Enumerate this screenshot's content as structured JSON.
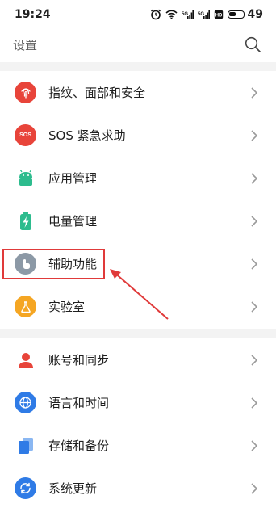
{
  "status_bar": {
    "time": "19:24",
    "battery": "49"
  },
  "header": {
    "title": "设置"
  },
  "group1": [
    {
      "label": "指纹、面部和安全",
      "icon": "fingerprint-icon",
      "color": "#e8443a"
    },
    {
      "label": "SOS 紧急求助",
      "icon": "sos-icon",
      "color": "#e8443a"
    },
    {
      "label": "应用管理",
      "icon": "android-icon",
      "color": "#2dbc8e"
    },
    {
      "label": "电量管理",
      "icon": "battery-charge-icon",
      "color": "#2dbc8e"
    },
    {
      "label": "辅助功能",
      "icon": "hand-pointer-icon",
      "color": "#8c99a6"
    },
    {
      "label": "实验室",
      "icon": "flask-icon",
      "color": "#f5a623"
    }
  ],
  "group2": [
    {
      "label": "账号和同步",
      "icon": "person-icon",
      "color": "#e8443a"
    },
    {
      "label": "语言和时间",
      "icon": "globe-icon",
      "color": "#2f7be6"
    },
    {
      "label": "存储和备份",
      "icon": "storage-icon",
      "color": "#2f7be6"
    },
    {
      "label": "系统更新",
      "icon": "update-icon",
      "color": "#2f7be6"
    }
  ],
  "sos_badge": "SOS"
}
